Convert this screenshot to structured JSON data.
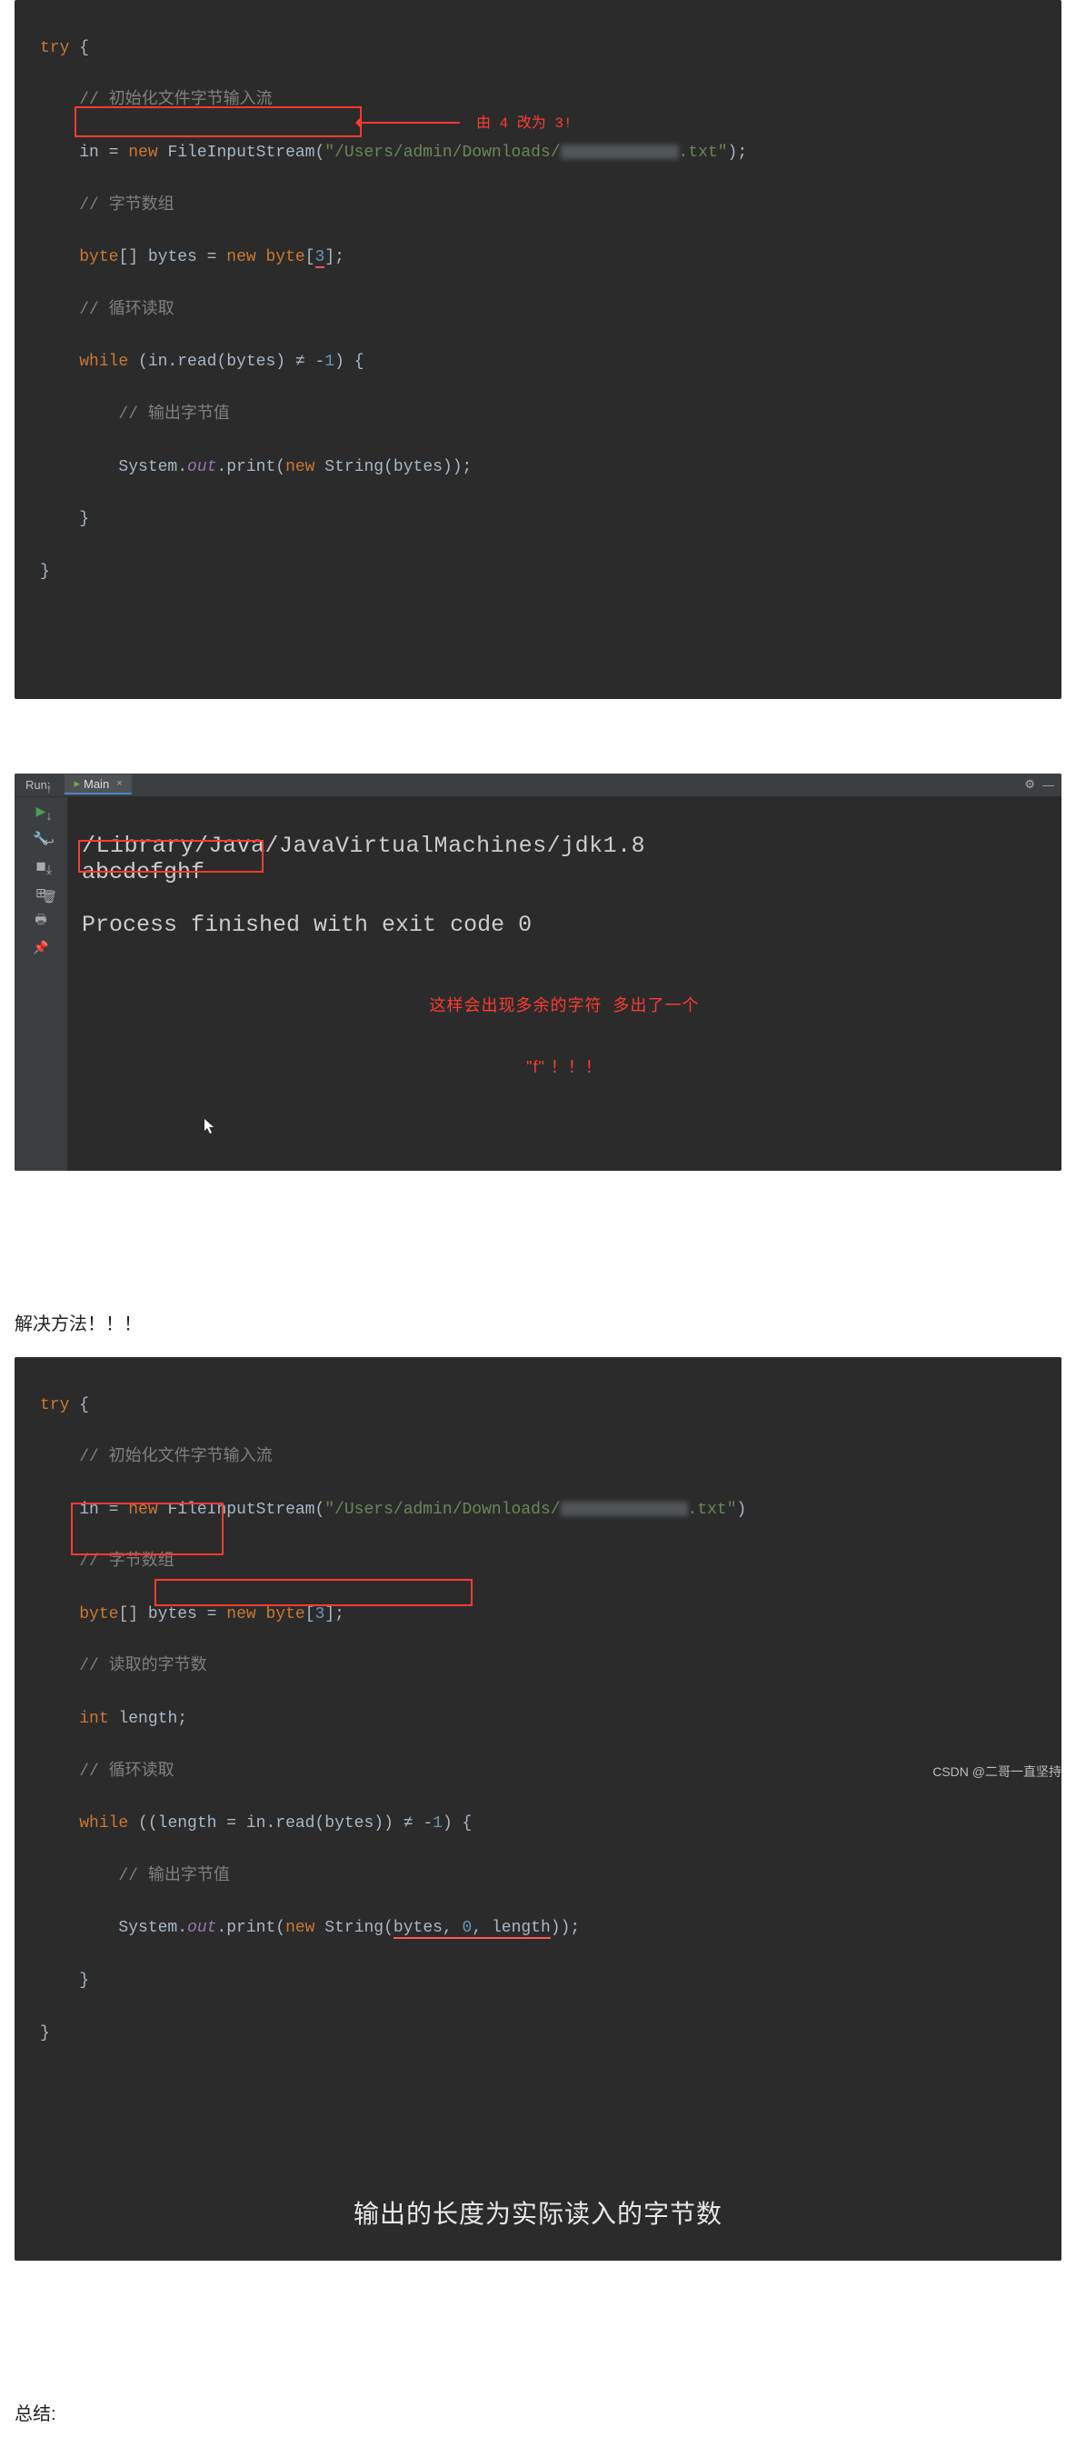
{
  "block1": {
    "try": "try",
    "brace_open": " {",
    "c1": "// 初始化文件字节输入流",
    "l2a": "in = ",
    "l2b": "new ",
    "l2c": "FileInputStream(",
    "l2d": "\"/Users/admin/Downloads/",
    "l2e": ".txt\"",
    "l2f": ");",
    "c2": "// 字节数组",
    "l3a": "byte",
    "l3b": "[] bytes = ",
    "l3c": "new byte",
    "l3d": "[",
    "l3e": "3",
    "l3f": "];",
    "c3": "// 循环读取",
    "l4a": "while ",
    "l4b": "(in.read(bytes) ",
    "l4c": "≠",
    "l4d": " -",
    "l4e": "1",
    "l4f": ") {",
    "c4": "// 输出字节值",
    "l5a": "System.",
    "l5b": "out",
    "l5c": ".print(",
    "l5d": "new ",
    "l5e": "String(bytes));",
    "brace_c1": "}",
    "brace_c2": "}",
    "note": "由 4 改为 3!"
  },
  "run": {
    "label": "Run:",
    "tab": "Main",
    "path": "/Library/Java/JavaVirtualMachines/jdk1.8",
    "output": "abcdefghf",
    "exit": "Process finished with exit code 0",
    "annot_l1": "这样会出现多余的字符  多出了一个",
    "annot_l2": "\"f\" ！！！"
  },
  "heading": "解决方法！！！",
  "block3": {
    "try": "try",
    "brace_open": " {",
    "c1": "// 初始化文件字节输入流",
    "l2a": "in = ",
    "l2b": "new ",
    "l2c": "FileInputStream(",
    "l2d": "\"/Users/admin/Downloads/",
    "l2e": ".txt\"",
    "l2f": ")",
    "c2": "// 字节数组",
    "l3a": "byte",
    "l3b": "[] bytes = ",
    "l3c": "new byte",
    "l3d": "[",
    "l3e": "3",
    "l3f": "];",
    "c3": "// 读取的字节数",
    "l4a": "int ",
    "l4b": "length;",
    "c4": "// 循环读取",
    "l5a": "while ",
    "l5b": "(",
    "l5c": "(length = in.read(bytes)) ",
    "l5d": "≠",
    "l5e": " -",
    "l5f": "1",
    "l5g": ") ",
    "l5h": "{",
    "c5": "// 输出字节值",
    "l6a": "System.",
    "l6b": "out",
    "l6c": ".print(",
    "l6d": "new ",
    "l6e": "String(",
    "l6f": "bytes, ",
    "l6g": "0",
    "l6h": ", length",
    "l6i": "));",
    "brace_c1": "}",
    "brace_c2": "}",
    "caption": "输出的长度为实际读入的字节数"
  },
  "summary": "总结:",
  "watermark": "CSDN @二哥一直坚持"
}
